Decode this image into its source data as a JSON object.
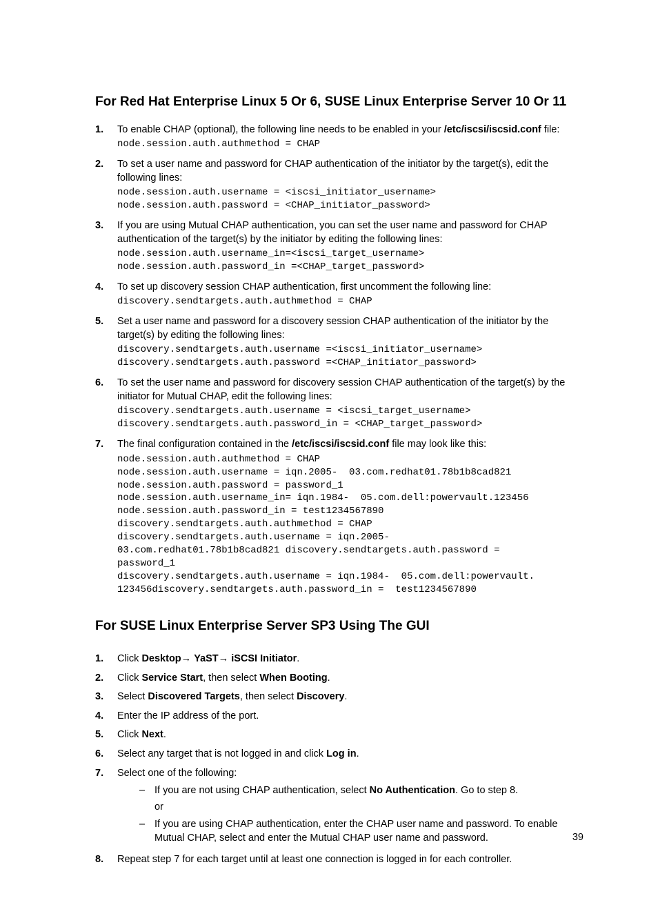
{
  "h1": "For Red Hat Enterprise Linux 5 Or 6, SUSE Linux Enterprise Server 10 Or 11",
  "s1": {
    "i1": {
      "num": "1.",
      "t1": "To enable CHAP (optional), the following line needs to be enabled in your ",
      "b1": "/etc/iscsi/iscsid.conf",
      "t2": " file:",
      "code": "node.session.auth.authmethod = CHAP"
    },
    "i2": {
      "num": "2.",
      "t": "To set a user name and password for CHAP authentication of the initiator by the target(s), edit the following lines:",
      "code": "node.session.auth.username = <iscsi_initiator_username>\nnode.session.auth.password = <CHAP_initiator_password>"
    },
    "i3": {
      "num": "3.",
      "t": "If you are using Mutual CHAP authentication, you can set the user name and password for CHAP authentication of the target(s) by the initiator by editing the following lines:",
      "code": "node.session.auth.username_in=<iscsi_target_username>\nnode.session.auth.password_in =<CHAP_target_password>"
    },
    "i4": {
      "num": "4.",
      "t": "To set up discovery session CHAP authentication, first uncomment the following line:",
      "code": "discovery.sendtargets.auth.authmethod = CHAP"
    },
    "i5": {
      "num": "5.",
      "t": "Set a user name and password for a discovery session CHAP authentication of the initiator by the target(s) by editing the following lines:",
      "code": "discovery.sendtargets.auth.username =<iscsi_initiator_username>\ndiscovery.sendtargets.auth.password =<CHAP_initiator_password>"
    },
    "i6": {
      "num": "6.",
      "t": "To set the user name and password for discovery session CHAP authentication of the target(s) by the initiator for Mutual CHAP, edit the following lines:",
      "code": "discovery.sendtargets.auth.username = <iscsi_target_username>\ndiscovery.sendtargets.auth.password_in = <CHAP_target_password>"
    },
    "i7": {
      "num": "7.",
      "t1": "The final configuration contained in the ",
      "b1": "/etc/iscsi/iscsid.conf",
      "t2": " file may look like this:",
      "code": "node.session.auth.authmethod = CHAP\nnode.session.auth.username = iqn.2005-  03.com.redhat01.78b1b8cad821\nnode.session.auth.password = password_1\nnode.session.auth.username_in= iqn.1984-  05.com.dell:powervault.123456\nnode.session.auth.password_in = test1234567890\ndiscovery.sendtargets.auth.authmethod = CHAP\ndiscovery.sendtargets.auth.username = iqn.2005-\n03.com.redhat01.78b1b8cad821 discovery.sendtargets.auth.password =\npassword_1\ndiscovery.sendtargets.auth.username = iqn.1984-  05.com.dell:powervault.\n123456discovery.sendtargets.auth.password_in =  test1234567890"
    }
  },
  "h2": "For SUSE Linux Enterprise Server SP3 Using The GUI",
  "s2": {
    "i1": {
      "num": "1.",
      "p1": "Click ",
      "b1": "Desktop",
      "a": "→ ",
      "b2": "YaST",
      "b3": "iSCSI Initiator",
      "dot": "."
    },
    "i2": {
      "num": "2.",
      "p1": "Click ",
      "b1": "Service Start",
      "p2": ", then select ",
      "b2": "When Booting",
      "dot": "."
    },
    "i3": {
      "num": "3.",
      "p1": "Select ",
      "b1": "Discovered Targets",
      "p2": ", then select ",
      "b2": "Discovery",
      "dot": "."
    },
    "i4": {
      "num": "4.",
      "t": "Enter the IP address of the port."
    },
    "i5": {
      "num": "5.",
      "p1": "Click ",
      "b1": "Next",
      "dot": "."
    },
    "i6": {
      "num": "6.",
      "p1": "Select any target that is not logged in and click ",
      "b1": "Log in",
      "dot": "."
    },
    "i7": {
      "num": "7.",
      "t": "Select one of the following:",
      "sub1": {
        "p1": "If you are not using CHAP authentication, select ",
        "b1": "No Authentication",
        "p2": ". Go to step 8.",
        "or": "or"
      },
      "sub2": {
        "t": "If you are using CHAP authentication, enter the CHAP user name and password. To enable Mutual CHAP, select and enter the Mutual CHAP user name and password."
      }
    },
    "i8": {
      "num": "8.",
      "t": "Repeat step 7 for each target until at least one connection is logged in for each controller."
    }
  },
  "dash": "–",
  "pagenum": "39"
}
